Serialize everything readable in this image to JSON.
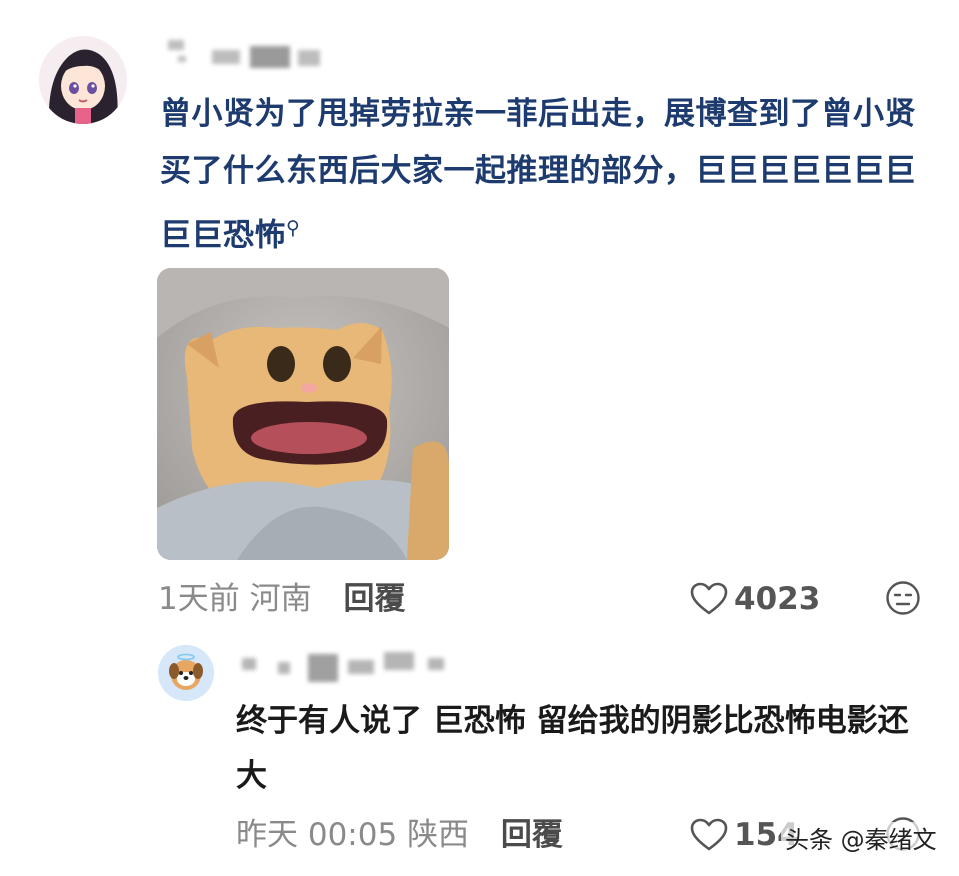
{
  "comment": {
    "text": "曾小贤为了甩掉劳拉亲一菲后出走，展博查到了曾小贤买了什么东西后大家一起推理的部分，巨巨巨巨巨巨巨巨巨恐怖",
    "search_icon": "search-icon",
    "time": "1天前",
    "location": "河南",
    "reply_label": "回覆",
    "likes": "4023",
    "emoji_icon": "neutral-face-icon"
  },
  "reply": {
    "text": "终于有人说了 巨恐怖 留给我的阴影比恐怖电影还大",
    "time": "昨天 00:05",
    "location": "陕西",
    "reply_label": "回覆",
    "likes": "154"
  },
  "watermark": "头条 @秦绪文",
  "colors": {
    "comment_text": "#1d3b6e",
    "meta": "#8a8a8a",
    "reply_text": "#1a1a1a"
  }
}
